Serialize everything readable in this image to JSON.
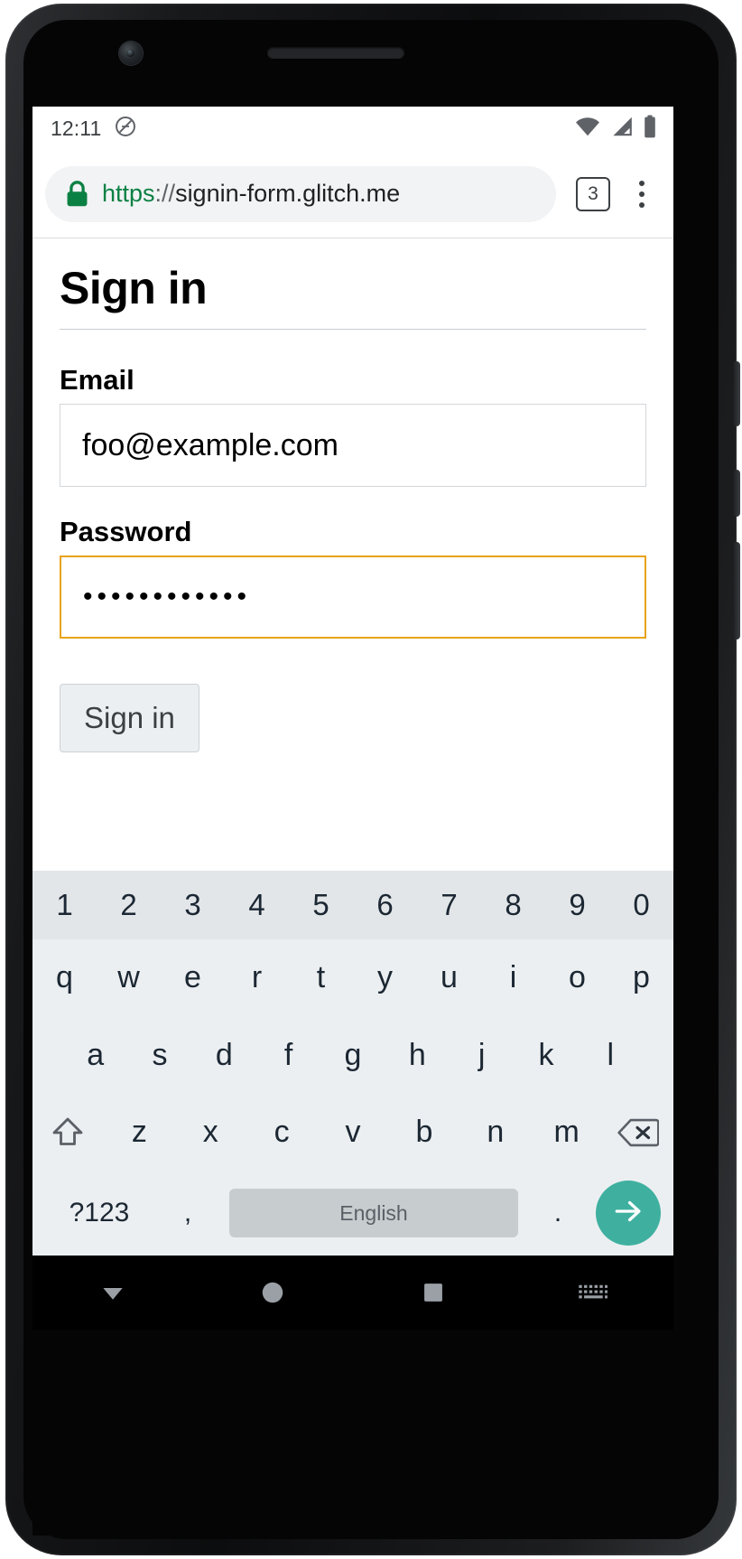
{
  "device": {
    "name": "android-phone",
    "earpiece": "earpiece-speaker",
    "camera": "front-camera"
  },
  "status_bar": {
    "time": "12:11",
    "icons": [
      {
        "name": "do-not-disturb-icon",
        "glyph": "ⓧ"
      },
      {
        "name": "wifi-icon"
      },
      {
        "name": "cellular-signal-icon"
      },
      {
        "name": "battery-icon"
      }
    ]
  },
  "browser": {
    "url_scheme": "https",
    "url_separator": "://",
    "url_host": "signin-form.glitch.me",
    "lock_icon": "lock-icon",
    "lock_color": "#0b8043",
    "tab_count": "3",
    "menu_icon": "overflow-menu-icon"
  },
  "page": {
    "title": "Sign in",
    "fields": [
      {
        "label": "Email",
        "value": "foo@example.com",
        "placeholder": "",
        "focused": false
      },
      {
        "label": "Password",
        "value": "••••••••••••",
        "placeholder": "",
        "focused": true
      }
    ],
    "submit_label": "Sign in",
    "focus_color": "#e8a317"
  },
  "keyboard": {
    "number_row": [
      "1",
      "2",
      "3",
      "4",
      "5",
      "6",
      "7",
      "8",
      "9",
      "0"
    ],
    "row_1": [
      "q",
      "w",
      "e",
      "r",
      "t",
      "y",
      "u",
      "i",
      "o",
      "p"
    ],
    "row_2": [
      "a",
      "s",
      "d",
      "f",
      "g",
      "h",
      "j",
      "k",
      "l"
    ],
    "row_3": [
      "z",
      "x",
      "c",
      "v",
      "b",
      "n",
      "m"
    ],
    "shift_key": "shift-icon",
    "backspace_key": "backspace-icon",
    "symbols_label": "?123",
    "comma_label": ",",
    "space_label": "English",
    "period_label": ".",
    "enter_icon": "arrow-right-icon",
    "enter_color": "#3fb0a0"
  },
  "nav_bar": {
    "buttons": [
      {
        "name": "back-dismiss-keyboard-icon"
      },
      {
        "name": "home-icon"
      },
      {
        "name": "recents-icon"
      },
      {
        "name": "keyboard-switcher-icon"
      }
    ]
  }
}
